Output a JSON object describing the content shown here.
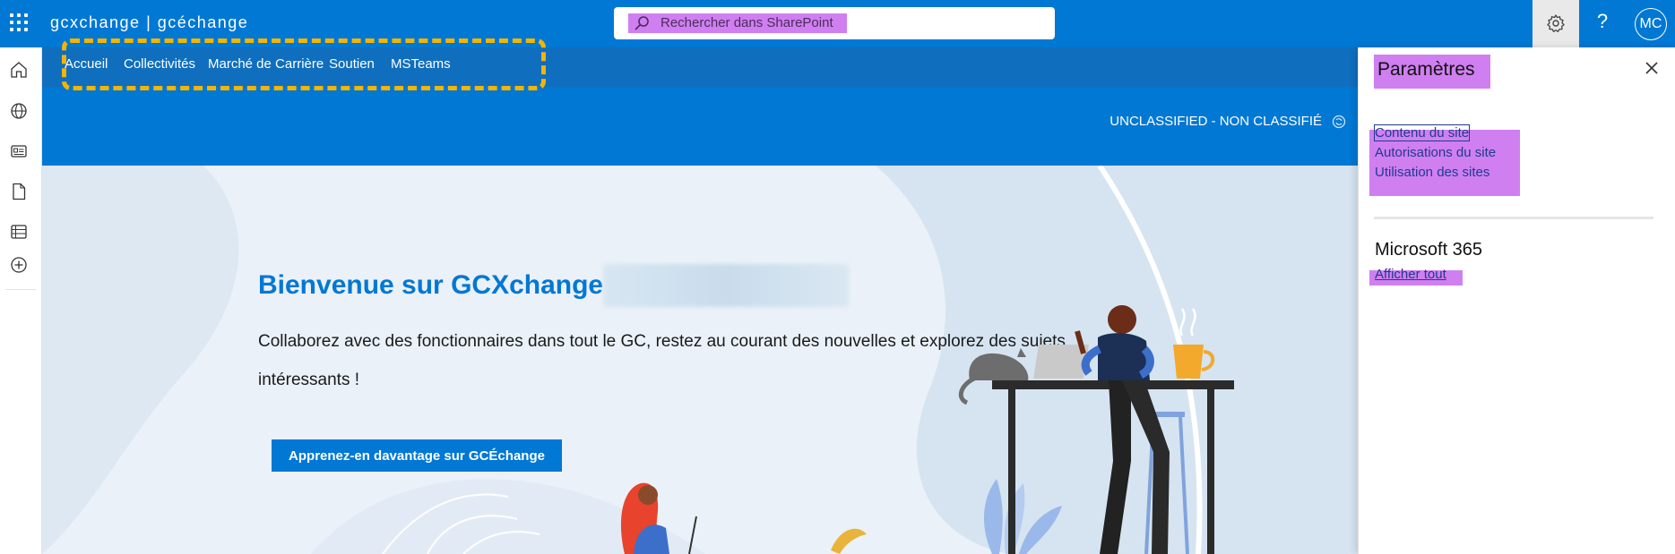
{
  "suitebar": {
    "brand": "gcxchange | gcéchange",
    "search_placeholder": "Rechercher dans SharePoint",
    "help_label": "?",
    "avatar_initials": "MC"
  },
  "site": {
    "nav_items": [
      {
        "label": "Accueil"
      },
      {
        "label": "Collectivités"
      },
      {
        "label": "Marché de Carrière"
      },
      {
        "label": "Soutien"
      },
      {
        "label": "MSTeams"
      }
    ],
    "classification": "UNCLASSIFIED - NON CLASSIFIÉ"
  },
  "hero": {
    "title": "Bienvenue sur GCXchange",
    "description": "Collaborez avec des fonctionnaires dans tout le GC, restez au courant des nouvelles et explorez des sujets intéressants !",
    "cta_label": "Apprenez-en davantage sur GCÉchange"
  },
  "settings_panel": {
    "title": "Paramètres",
    "links": [
      {
        "label": "Contenu du site"
      },
      {
        "label": "Autorisations du site"
      },
      {
        "label": "Utilisation des sites"
      }
    ],
    "section_heading": "Microsoft 365",
    "show_all_label": "Afficher tout"
  },
  "colors": {
    "brand_blue": "#0078d4",
    "highlight_purple": "#cf7ff0",
    "nav_outline_yellow": "#f4b400"
  },
  "icons": {
    "rail": [
      "home-icon",
      "globe-icon",
      "news-icon",
      "file-icon",
      "list-icon",
      "add-icon"
    ],
    "suitebar": [
      "app-launcher-icon",
      "search-icon",
      "gear-icon",
      "help-icon"
    ],
    "panel": [
      "close-icon"
    ]
  }
}
